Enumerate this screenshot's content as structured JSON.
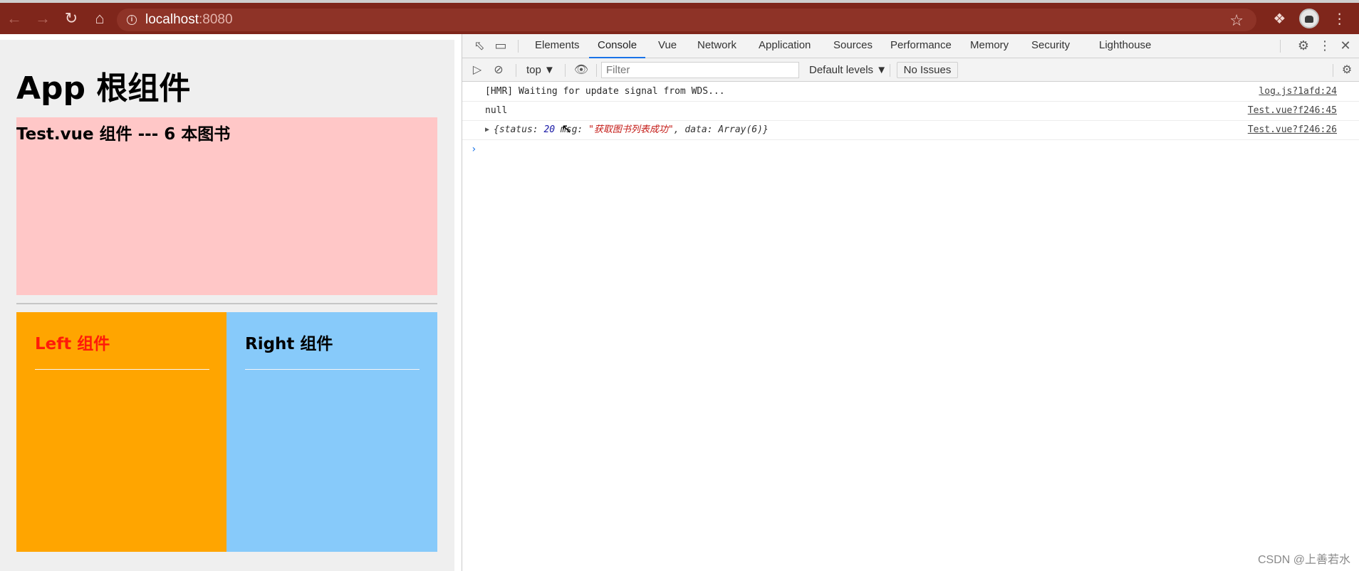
{
  "browser": {
    "url_host": "localhost",
    "url_port": ":8080",
    "icons": {
      "back": "arrow-left-icon",
      "forward": "arrow-right-icon",
      "reload": "reload-icon",
      "home": "home-icon",
      "info": "info-icon",
      "star": "star-icon",
      "extensions": "puzzle-icon",
      "menu": "kebab-menu-icon"
    }
  },
  "page": {
    "app_title": "App 根组件",
    "test_title": "Test.vue 组件 --- 6 本图书",
    "left_title": "Left 组件",
    "right_title": "Right 组件",
    "colors": {
      "test_bg": "#ffc7c7",
      "left_bg": "#ffa500",
      "right_bg": "#87cafa",
      "left_title": "#ff1a0a"
    }
  },
  "devtools": {
    "tabs": [
      {
        "label": "Elements"
      },
      {
        "label": "Console",
        "active": true
      },
      {
        "label": "Vue"
      },
      {
        "label": "Network"
      },
      {
        "label": "Application"
      },
      {
        "label": "Sources"
      },
      {
        "label": "Performance"
      },
      {
        "label": "Memory"
      },
      {
        "label": "Security"
      },
      {
        "label": "Lighthouse"
      }
    ],
    "toolbar": {
      "context": "top ▼",
      "filter_placeholder": "Filter",
      "levels": "Default levels ▼",
      "issues": "No Issues"
    },
    "logs": [
      {
        "text": "[HMR] Waiting for update signal from WDS...",
        "source": "log.js?1afd:24"
      },
      {
        "text": "null",
        "source": "Test.vue?f246:45"
      },
      {
        "object": {
          "open": "{status: ",
          "status": "20",
          "mid": " msg: ",
          "msg": "\"获取图书列表成功\"",
          "tail": ", data: Array(6)}"
        },
        "source": "Test.vue?f246:26"
      }
    ],
    "prompt": "›"
  },
  "watermark": "CSDN @上善若水"
}
